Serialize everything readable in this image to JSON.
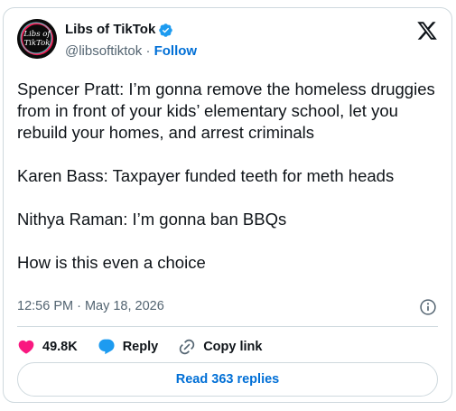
{
  "author": {
    "name": "Libs of TikTok",
    "handle": "@libsoftiktok",
    "separator": "·",
    "follow_label": "Follow",
    "avatar_text_line1": "Libs of",
    "avatar_text_line2": "TikTok"
  },
  "tweet": {
    "paragraphs": [
      "Spencer Pratt: I’m gonna remove the homeless druggies from in front of your kids’ elementary school, let you rebuild your homes, and arrest criminals",
      "Karen Bass: Taxpayer funded teeth for meth heads",
      "Nithya Raman: I’m gonna ban BBQs",
      "How is this even a choice"
    ],
    "timestamp": "12:56 PM · May 18, 2026"
  },
  "actions": {
    "likes": "49.8K",
    "reply_label": "Reply",
    "copy_link_label": "Copy link"
  },
  "read_replies_label": "Read 363 replies",
  "colors": {
    "like": "#f91880",
    "reply": "#1d9bf0",
    "link": "#006fd6",
    "verified": "#1d9bf0"
  },
  "icons": [
    "x-logo-icon",
    "verified-badge-icon",
    "info-icon",
    "heart-icon",
    "reply-bubble-icon",
    "link-icon"
  ]
}
